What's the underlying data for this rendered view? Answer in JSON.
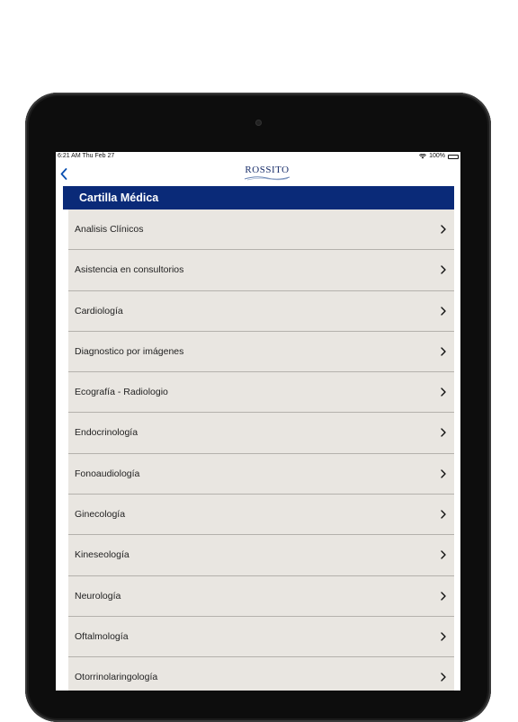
{
  "status_bar": {
    "time_date": "6:21 AM   Thu Feb 27",
    "battery": "100%"
  },
  "navbar": {
    "logo_text": "ROSSITO"
  },
  "header": {
    "title": "Cartilla Médica"
  },
  "colors": {
    "header_bg": "#0a2a78",
    "list_bg": "#e9e6e1",
    "accent": "#1a2f6b"
  },
  "list": {
    "items": [
      {
        "label": "Analisis Clínicos"
      },
      {
        "label": "Asistencia en consultorios"
      },
      {
        "label": "Cardiología"
      },
      {
        "label": "Diagnostico por imágenes"
      },
      {
        "label": "Ecografía - Radiologio"
      },
      {
        "label": "Endocrinología"
      },
      {
        "label": "Fonoaudiología"
      },
      {
        "label": "Ginecología"
      },
      {
        "label": "Kineseología"
      },
      {
        "label": "Neurología"
      },
      {
        "label": "Oftalmología"
      },
      {
        "label": "Otorrinolaringología"
      }
    ]
  }
}
